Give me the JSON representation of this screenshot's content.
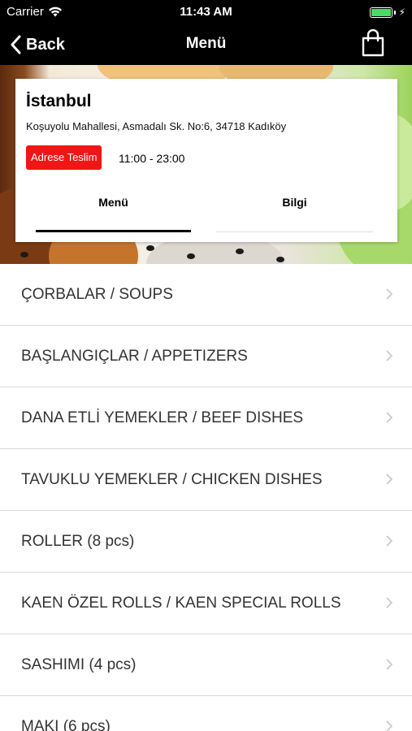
{
  "status_bar": {
    "carrier": "Carrier",
    "time": "11:43 AM",
    "battery_level": 1.0
  },
  "nav": {
    "back_label": "Back",
    "title": "Menü"
  },
  "restaurant": {
    "city": "İstanbul",
    "address": "Koşuyolu Mahallesi, Asmadalı Sk. No:6, 34718 Kadıköy",
    "delivery_badge": "Adrese Teslim",
    "hours": "11:00 - 23:00"
  },
  "tabs": [
    {
      "label": "Menü",
      "selected": true
    },
    {
      "label": "Bilgi",
      "selected": false
    }
  ],
  "categories": [
    {
      "label": "ÇORBALAR / SOUPS"
    },
    {
      "label": "BAŞLANGIÇLAR / APPETIZERS"
    },
    {
      "label": "DANA ETLİ YEMEKLER / BEEF DISHES"
    },
    {
      "label": "TAVUKLU YEMEKLER / CHICKEN DISHES"
    },
    {
      "label": "ROLLER (8 pcs)"
    },
    {
      "label": "KAEN ÖZEL ROLLS / KAEN SPECIAL ROLLS"
    },
    {
      "label": "SASHIMI (4 pcs)"
    },
    {
      "label": "MAKI (6 pcs)"
    }
  ],
  "colors": {
    "accent": "#f01616",
    "battery": "#4cd964",
    "bar": "#000000"
  }
}
